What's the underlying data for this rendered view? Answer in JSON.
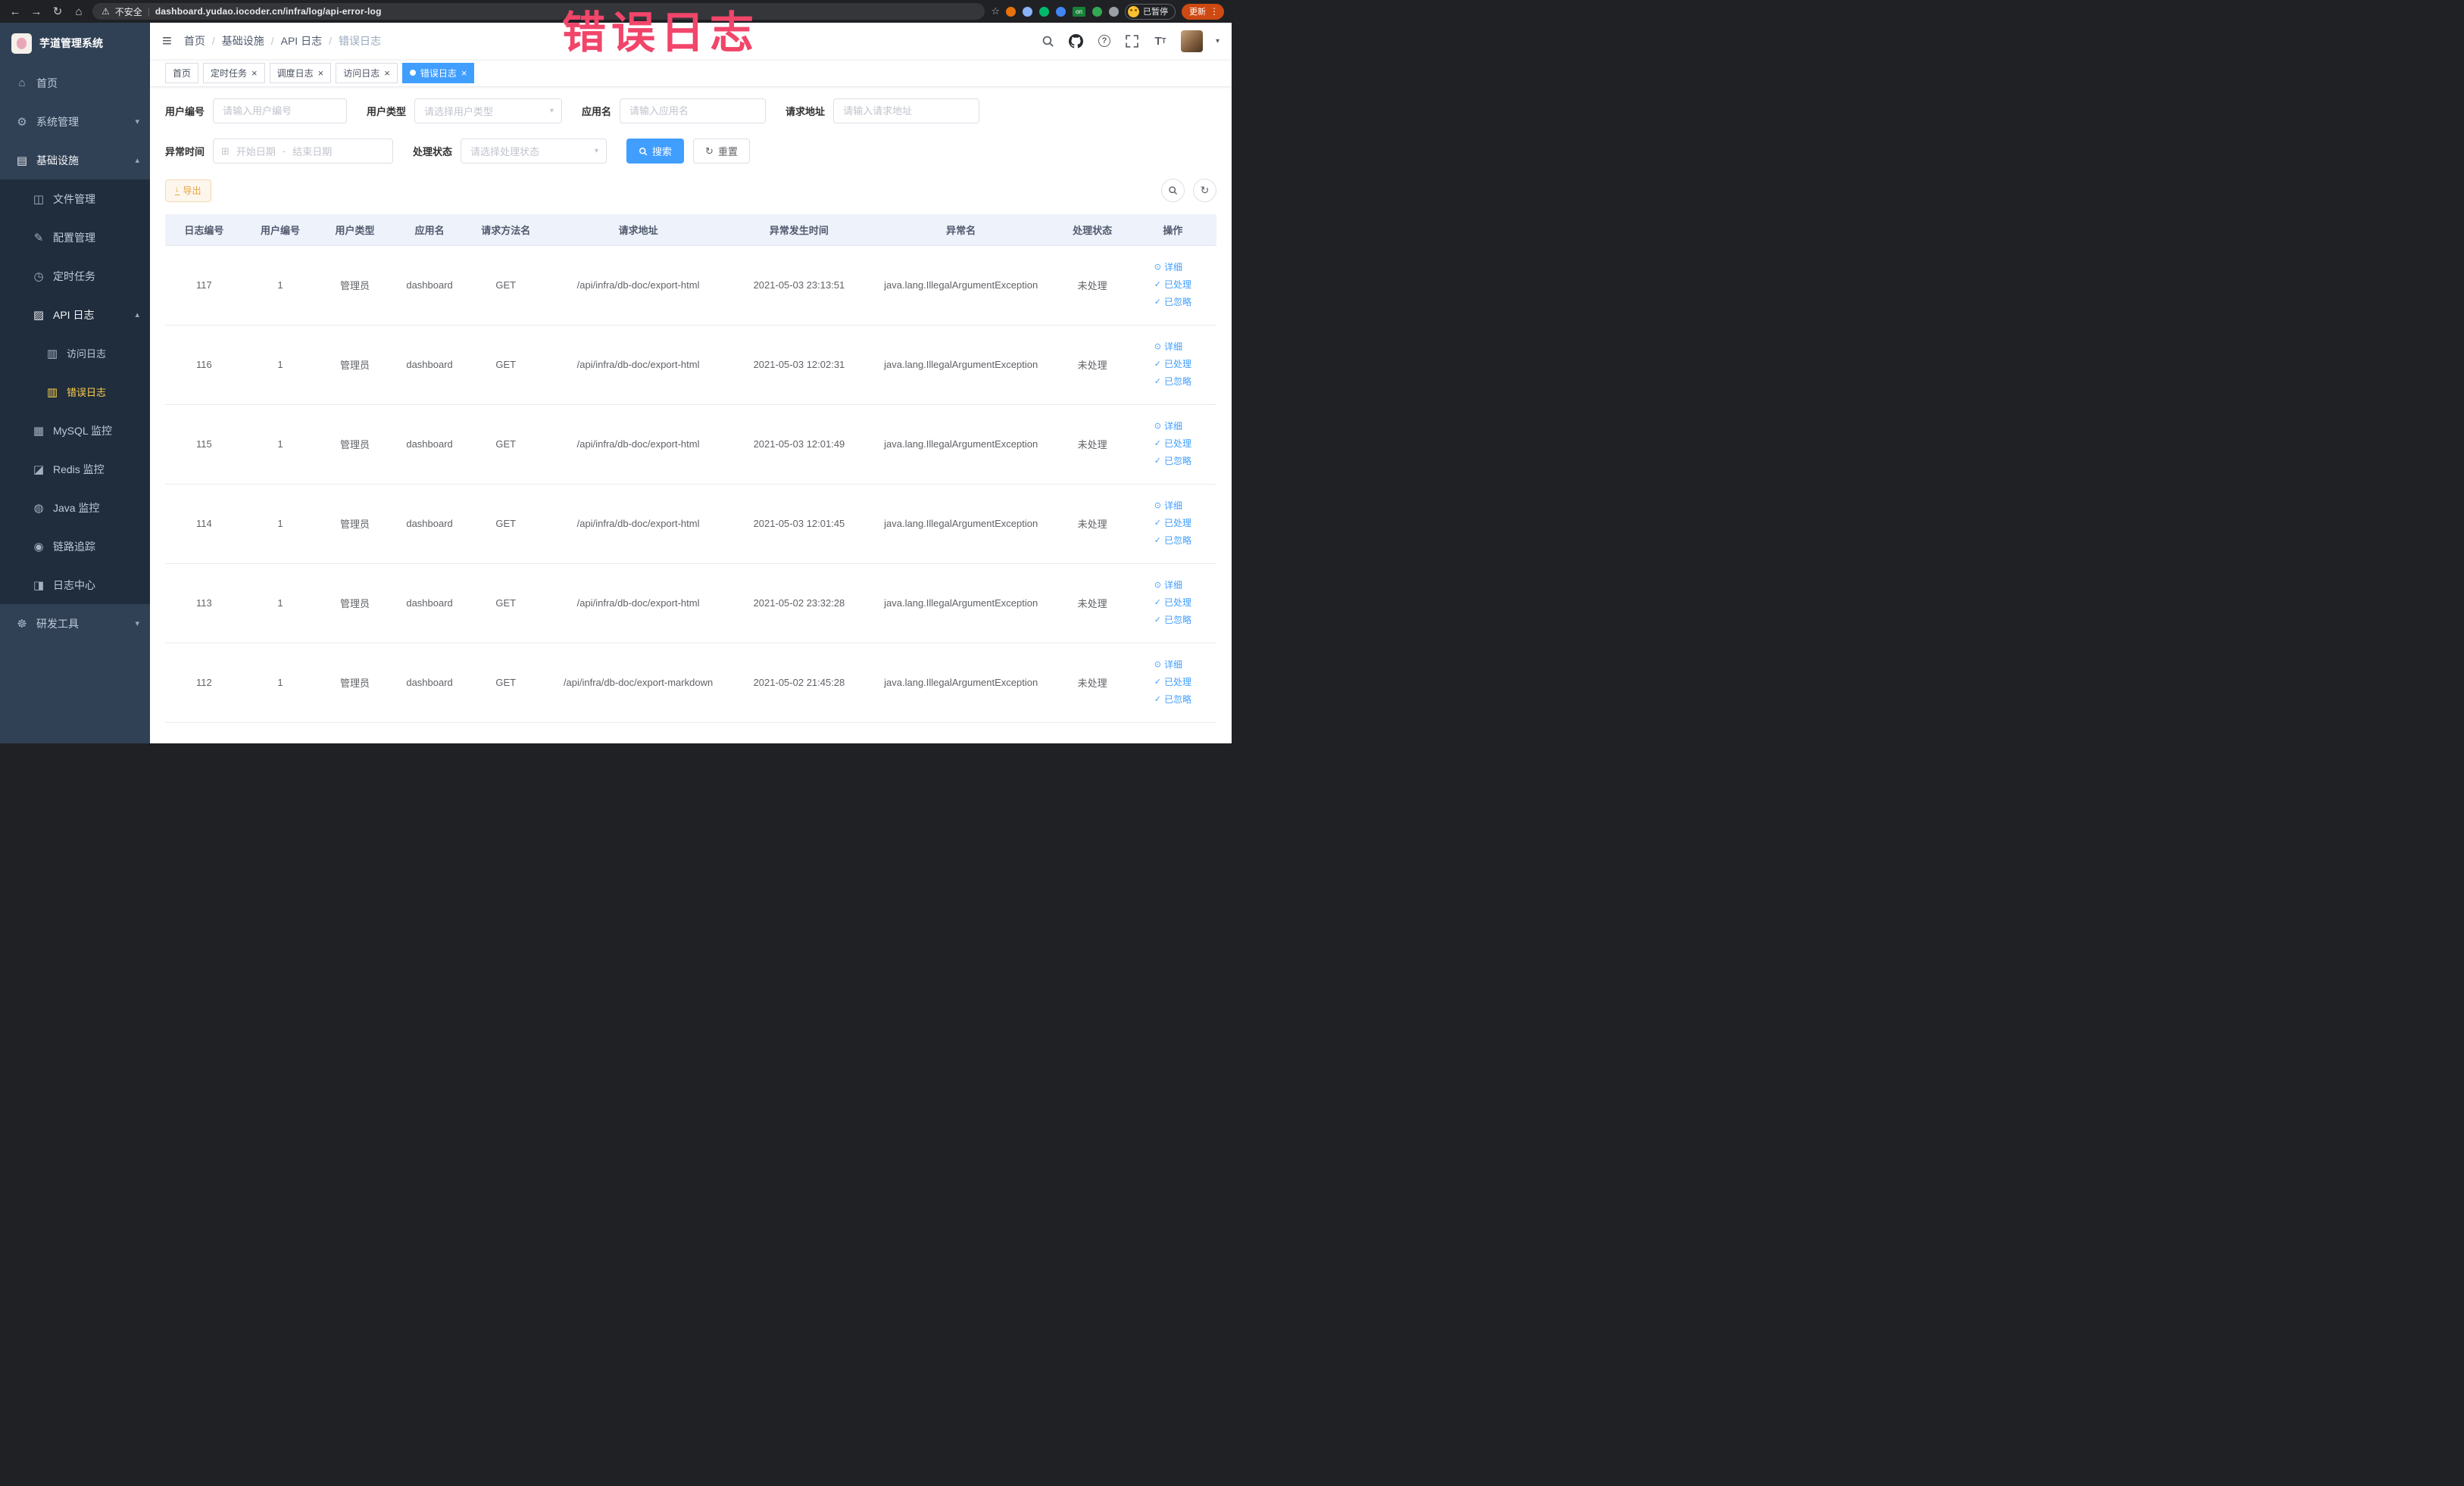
{
  "theme": {
    "accent": "#409eff",
    "sidebar_bg": "#304156",
    "submenu_bg": "#1f2d3d",
    "sidebar_active": "#ffd04b",
    "annotation_color": "#f1456a"
  },
  "browser": {
    "security_label": "不安全",
    "url": "dashboard.yudao.iocoder.cn/infra/log/api-error-log",
    "paused_button": "已暂停",
    "update_button": "更新",
    "extensions": [
      {
        "name": "extension-icon-orange",
        "color": "#e8710a"
      },
      {
        "name": "extension-icon-lightblue",
        "color": "#8ab4f8"
      },
      {
        "name": "extension-icon-green-circle",
        "color": "#00b96b"
      },
      {
        "name": "extension-icon-blue-grid",
        "color": "#4285f4"
      },
      {
        "name": "extension-icon-on-badge",
        "color": "#188038",
        "text": "on"
      },
      {
        "name": "extension-icon-green-leaf",
        "color": "#34a853"
      },
      {
        "name": "extension-icon-puzzle",
        "color": "#9aa0a6"
      }
    ]
  },
  "annotation": {
    "text": "错误日志"
  },
  "sidebar": {
    "app_title": "芋道管理系统",
    "menu": [
      {
        "label": "首页",
        "icon": "home-icon",
        "level": 1
      },
      {
        "label": "系统管理",
        "icon": "gear-icon",
        "level": 1,
        "expandable": true,
        "expanded": false
      },
      {
        "label": "基础设施",
        "icon": "infra-icon",
        "level": 1,
        "expandable": true,
        "expanded": true,
        "highlight": true
      },
      {
        "label": "文件管理",
        "icon": "folder-icon",
        "level": 2
      },
      {
        "label": "配置管理",
        "icon": "edit-icon",
        "level": 2
      },
      {
        "label": "定时任务",
        "icon": "timer-icon",
        "level": 2
      },
      {
        "label": "API 日志",
        "icon": "api-log-icon",
        "level": 2,
        "expandable": true,
        "expanded": true,
        "highlight": true
      },
      {
        "label": "访问日志",
        "icon": "access-log-icon",
        "level": 3
      },
      {
        "label": "错误日志",
        "icon": "error-log-icon",
        "level": 3,
        "active": true
      },
      {
        "label": "MySQL 监控",
        "icon": "database-icon",
        "level": 2
      },
      {
        "label": "Redis 监控",
        "icon": "redis-icon",
        "level": 2
      },
      {
        "label": "Java 监控",
        "icon": "java-icon",
        "level": 2
      },
      {
        "label": "链路追踪",
        "icon": "trace-icon",
        "level": 2
      },
      {
        "label": "日志中心",
        "icon": "log-center-icon",
        "level": 2
      },
      {
        "label": "研发工具",
        "icon": "devtools-icon",
        "level": 1,
        "expandable": true,
        "expanded": false
      }
    ]
  },
  "navbar": {
    "breadcrumb": [
      "首页",
      "基础设施",
      "API 日志",
      "错误日志"
    ]
  },
  "tabs": [
    {
      "label": "首页",
      "closable": false,
      "active": false
    },
    {
      "label": "定时任务",
      "closable": true,
      "active": false
    },
    {
      "label": "调度日志",
      "closable": true,
      "active": false
    },
    {
      "label": "访问日志",
      "closable": true,
      "active": false
    },
    {
      "label": "错误日志",
      "closable": true,
      "active": true
    }
  ],
  "filters": {
    "user_id": {
      "label": "用户编号",
      "placeholder": "请输入用户编号"
    },
    "user_type": {
      "label": "用户类型",
      "placeholder": "请选择用户类型"
    },
    "app_name": {
      "label": "应用名",
      "placeholder": "请输入应用名"
    },
    "request_url": {
      "label": "请求地址",
      "placeholder": "请输入请求地址"
    },
    "exception_time": {
      "label": "异常时间",
      "start_placeholder": "开始日期",
      "separator": "-",
      "end_placeholder": "结束日期"
    },
    "process_status": {
      "label": "处理状态",
      "placeholder": "请选择处理状态"
    },
    "search_button": "搜索",
    "reset_button": "重置"
  },
  "toolbar": {
    "export_button": "导出"
  },
  "table": {
    "headers": [
      "日志编号",
      "用户编号",
      "用户类型",
      "应用名",
      "请求方法名",
      "请求地址",
      "异常发生时间",
      "异常名",
      "处理状态",
      "操作"
    ],
    "actions": {
      "detail": "详细",
      "processed": "已处理",
      "ignored": "已忽略"
    },
    "rows": [
      {
        "id": "117",
        "user_id": "1",
        "user_type": "管理员",
        "app": "dashboard",
        "method": "GET",
        "url": "/api/infra/db-doc/export-html",
        "time": "2021-05-03 23:13:51",
        "exception": "java.lang.IllegalArgumentException",
        "status": "未处理"
      },
      {
        "id": "116",
        "user_id": "1",
        "user_type": "管理员",
        "app": "dashboard",
        "method": "GET",
        "url": "/api/infra/db-doc/export-html",
        "time": "2021-05-03 12:02:31",
        "exception": "java.lang.IllegalArgumentException",
        "status": "未处理"
      },
      {
        "id": "115",
        "user_id": "1",
        "user_type": "管理员",
        "app": "dashboard",
        "method": "GET",
        "url": "/api/infra/db-doc/export-html",
        "time": "2021-05-03 12:01:49",
        "exception": "java.lang.IllegalArgumentException",
        "status": "未处理"
      },
      {
        "id": "114",
        "user_id": "1",
        "user_type": "管理员",
        "app": "dashboard",
        "method": "GET",
        "url": "/api/infra/db-doc/export-html",
        "time": "2021-05-03 12:01:45",
        "exception": "java.lang.IllegalArgumentException",
        "status": "未处理"
      },
      {
        "id": "113",
        "user_id": "1",
        "user_type": "管理员",
        "app": "dashboard",
        "method": "GET",
        "url": "/api/infra/db-doc/export-html",
        "time": "2021-05-02 23:32:28",
        "exception": "java.lang.IllegalArgumentException",
        "status": "未处理"
      },
      {
        "id": "112",
        "user_id": "1",
        "user_type": "管理员",
        "app": "dashboard",
        "method": "GET",
        "url": "/api/infra/db-doc/export-markdown",
        "time": "2021-05-02 21:45:28",
        "exception": "java.lang.IllegalArgumentException",
        "status": "未处理"
      }
    ]
  }
}
